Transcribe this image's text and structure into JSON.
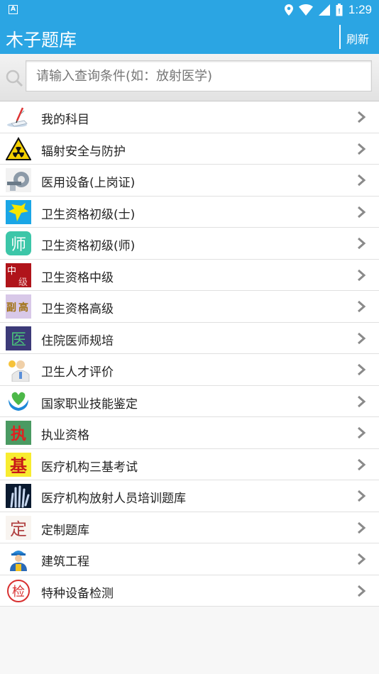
{
  "status": {
    "time": "1:29"
  },
  "appbar": {
    "title": "木子题库",
    "refresh_label": "刷新"
  },
  "search": {
    "placeholder": "请输入查询条件(如：放射医学)",
    "value": ""
  },
  "items": [
    {
      "label": "我的科目",
      "icon": "pen-paper-icon"
    },
    {
      "label": "辐射安全与防护",
      "icon": "radiation-warning-icon"
    },
    {
      "label": "医用设备(上岗证)",
      "icon": "ct-scanner-icon"
    },
    {
      "label": "卫生资格初级(士)",
      "icon": "nurse-star-icon"
    },
    {
      "label": "卫生资格初级(师)",
      "icon": "shi-character-icon"
    },
    {
      "label": "卫生资格中级",
      "icon": "zhongji-icon"
    },
    {
      "label": "卫生资格高级",
      "icon": "fugao-icon"
    },
    {
      "label": "住院医师规培",
      "icon": "yi-character-icon"
    },
    {
      "label": "卫生人才评价",
      "icon": "doctor-person-icon"
    },
    {
      "label": "国家职业技能鉴定",
      "icon": "heart-hands-icon"
    },
    {
      "label": "执业资格",
      "icon": "zhi-character-icon"
    },
    {
      "label": "医疗机构三基考试",
      "icon": "ji-character-icon"
    },
    {
      "label": "医疗机构放射人员培训题库",
      "icon": "xray-hand-icon"
    },
    {
      "label": "定制题库",
      "icon": "ding-character-icon"
    },
    {
      "label": "建筑工程",
      "icon": "construction-worker-icon"
    },
    {
      "label": "特种设备检测",
      "icon": "jian-seal-icon"
    }
  ],
  "colors": {
    "accent": "#2ba5e3",
    "chevron": "#8a8a8a"
  }
}
